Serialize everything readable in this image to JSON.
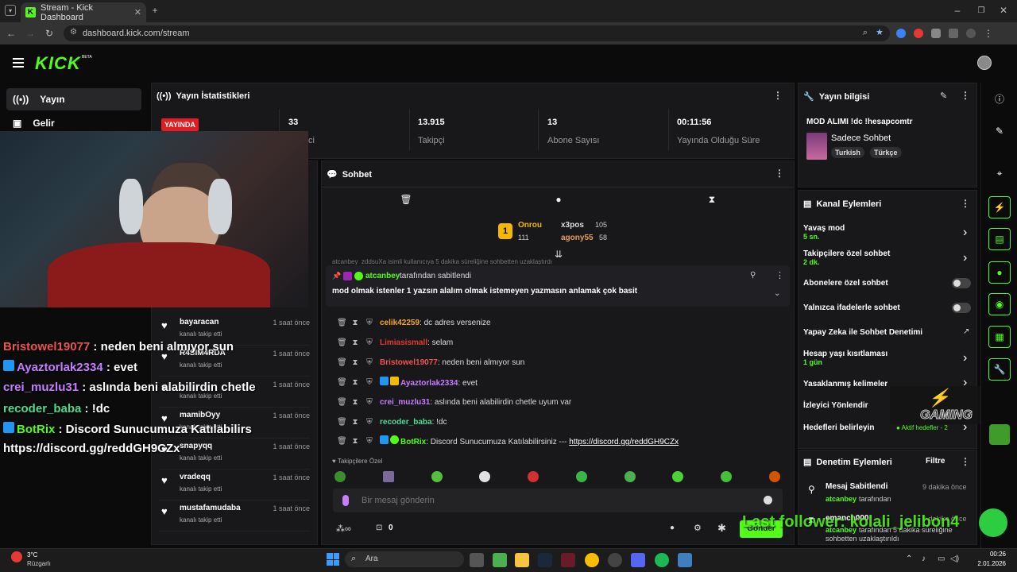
{
  "browser": {
    "tab_title": "Stream - Kick Dashboard",
    "url": "dashboard.kick.com/stream"
  },
  "header": {
    "logo": "KICK",
    "beta": "BETA"
  },
  "nav": [
    {
      "label": "Yayın",
      "icon": "broadcast-icon"
    },
    {
      "label": "Gelir",
      "icon": "revenue-icon"
    }
  ],
  "stats": {
    "title": "Yayın İstatistikleri",
    "live": "YAYINDA",
    "viewers": "33",
    "viewers_label": "İzleyici",
    "followers": "13.915",
    "followers_label": "Takipçi",
    "subs": "13",
    "subs_label": "Abone Sayısı",
    "duration": "00:11:56",
    "duration_label": "Yayında Olduğu Süre"
  },
  "chat": {
    "title": "Sohbet",
    "pinned_by_user": "atcanbey",
    "pinned_by_suffix": "tarafından sabitlendi",
    "pinned_text": "mod olmak istenler 1 yazsın alalım olmak istemeyen yazmasın anlamak çok basit",
    "hidden_line": "atcanbey_zddsuXa isimli kullanıcıya 5 dakika süreliğine sohbetten uzaklaştırdı",
    "leaders": [
      {
        "name": "Onrou",
        "score": "111"
      },
      {
        "name": "x3pos",
        "score": "105"
      },
      {
        "name": "agony55",
        "score": "58"
      }
    ],
    "messages": [
      {
        "user": "celik42259",
        "text": ": dc adres versenize",
        "color": "#f5a623"
      },
      {
        "user": "Limiasismall",
        "text": ": selam",
        "color": "#e53935"
      },
      {
        "user": "Bristowel19077",
        "text": ": neden beni almıyor sun",
        "color": "#ef5350"
      },
      {
        "user": "Ayaztorlak2334",
        "text": ": evet",
        "color": "#c77dff"
      },
      {
        "user": "crei_muzlu31",
        "text": ": aslında beni alabilirdin chetle uyum var",
        "color": "#c77dff"
      },
      {
        "user": "recoder_baba",
        "text": ": !dc",
        "color": "#4ddc8f"
      },
      {
        "user": "BotRix",
        "text": ": Discord Sunucumuza Katılabilirsiniz --- ",
        "link": "https://discord.gg/reddGH9CZx",
        "color": "#53fc18"
      }
    ],
    "followers_only": "Takipçilere Özel",
    "input_placeholder": "Bir mesaj gönderin",
    "points": "0",
    "send": "Gönder"
  },
  "followers": [
    {
      "name": "bayaracan",
      "sub": "kanalı takip etti",
      "time": "1 saat önce"
    },
    {
      "name": "R4SIM4RDA",
      "sub": "kanalı takip etti",
      "time": "1 saat önce"
    },
    {
      "name": "",
      "sub": "kanalı takip etti",
      "time": "1 saat önce"
    },
    {
      "name": "mamibOyy",
      "sub": "kanalı takip etti",
      "time": "1 saat önce"
    },
    {
      "name": "snapyqq",
      "sub": "kanalı takip etti",
      "time": "1 saat önce"
    },
    {
      "name": "vradeqq",
      "sub": "kanalı takip etti",
      "time": "1 saat önce"
    },
    {
      "name": "mustafamudaba",
      "sub": "kanalı takip etti",
      "time": "1 saat önce"
    }
  ],
  "overlay_chat": [
    {
      "user": "Bristowel19077",
      "text": " : neden beni almıyor sun",
      "color": "#ef5350"
    },
    {
      "user": "Ayaztorlak2334",
      "text": " : evet",
      "color": "#c77dff"
    },
    {
      "user": "crei_muzlu31",
      "text": " : aslında beni alabilirdin chetle",
      "color": "#c77dff"
    },
    {
      "user": "recoder_baba",
      "text": " : !dc",
      "color": "#4ddc8f"
    },
    {
      "user": "BotRix",
      "text": " : Discord Sunucumuza Katılabilirs",
      "color": "#53fc18"
    },
    {
      "user": "",
      "text": "https://discord.gg/reddGH9CZx",
      "color": "#fff"
    }
  ],
  "info": {
    "title": "Yayın bilgisi",
    "stream_title": "MOD ALIMI !dc !hesapcomtr",
    "category": "Sadece Sohbet",
    "tags": [
      "Turkish",
      "Türkçe"
    ]
  },
  "channel": {
    "title": "Kanal Eylemleri",
    "slow": "Yavaş mod",
    "slow_val": "5 sn.",
    "followers_chat": "Takipçilere özel sohbet",
    "followers_val": "2 dk.",
    "subs_chat": "Abonelere özel sohbet",
    "emote_chat": "Yalnızca ifadelerle sohbet",
    "ai_mod": "Yapay Zeka ile Sohbet Denetimi",
    "age": "Hesap yaşı kısıtlaması",
    "age_val": "1 gün",
    "banned": "Yasaklanmış kelimeler",
    "redirect": "İzleyici Yönlendir",
    "goals": "Hedefleri belirleyin",
    "goals_val": "Aktif hedefler - 2"
  },
  "moderation": {
    "title": "Denetim Eylemleri",
    "filter": "Filtre",
    "items": [
      {
        "title": "Mesaj Sabitlendi",
        "user": "atcanbey",
        "suffix": "tarafından",
        "time": "9 dakika önce"
      },
      {
        "title": "emanch000",
        "user": "atcanbey",
        "suffix": "tarafından 5 dakika süreliğine sohbetten uzaklaştırıldı",
        "time": "9 dakika önce"
      }
    ]
  },
  "overlay": {
    "last_follower": "Last follower: kolali_jelibon4",
    "gaming": "GAMING"
  },
  "taskbar": {
    "temp": "3°C",
    "weather": "Rüzgarlı",
    "search": "Ara",
    "time": "00:26",
    "date": "2.01.2026"
  },
  "colors": {
    "accent": "#53fc18",
    "live": "#e31b23"
  }
}
